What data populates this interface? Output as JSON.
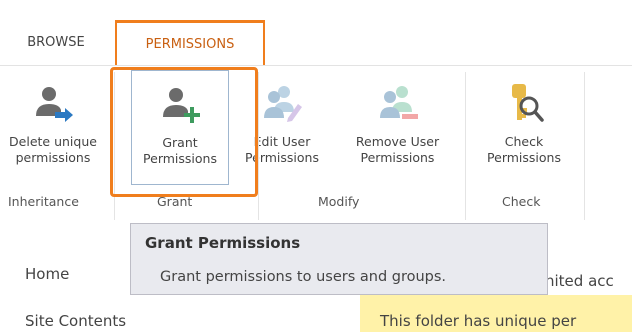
{
  "ribbon": {
    "tabs": [
      {
        "label": "BROWSE",
        "active": false
      },
      {
        "label": "PERMISSIONS",
        "active": true
      }
    ],
    "commands": {
      "delete_unique": {
        "label": "Delete unique\npermissions",
        "icon": "person-arrow-icon"
      },
      "grant": {
        "label": "Grant\nPermissions",
        "icon": "person-add-icon"
      },
      "edit_user": {
        "label": "Edit User\nPermissions",
        "icon": "users-edit-icon",
        "enabled": false
      },
      "remove_user": {
        "label": "Remove User\nPermissions",
        "icon": "users-remove-icon",
        "enabled": false
      },
      "check": {
        "label": "Check\nPermissions",
        "icon": "key-magnifier-icon"
      }
    },
    "groups": {
      "inheritance": "Inheritance",
      "grant": "Grant",
      "modify": "Modify",
      "check": "Check"
    }
  },
  "tooltip": {
    "title": "Grant Permissions",
    "description": "Grant permissions to users and groups."
  },
  "nav": {
    "home": "Home",
    "site_contents": "Site Contents"
  },
  "notification": {
    "line1": "nited acc",
    "line2": "This folder has unique per"
  },
  "colors": {
    "highlight": "#f07e1d",
    "tooltip_bg": "#e9eaef",
    "notification_bg": "#fff2a8",
    "icon_gray": "#6b6b6b",
    "icon_green": "#3e9b5e",
    "icon_blue": "#2b79c2",
    "key_gold": "#e7b948"
  }
}
